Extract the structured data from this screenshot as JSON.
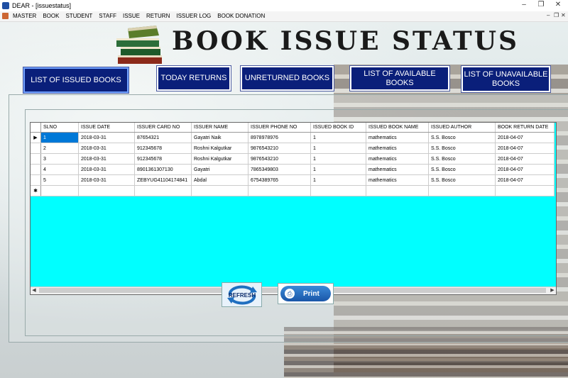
{
  "window": {
    "title": "DEAR - [issuestatus]",
    "minimize": "–",
    "restore": "❐",
    "close": "✕"
  },
  "menu": {
    "items": [
      "MASTER",
      "BOOK",
      "STUDENT",
      "STAFF",
      "ISSUE",
      "RETURN",
      "ISSUER LOG",
      "BOOK DONATION"
    ]
  },
  "page": {
    "title": "BOOK ISSUE STATUS"
  },
  "nav": {
    "list_issued": "LIST OF ISSUED BOOKS",
    "today_returns": "TODAY RETURNS",
    "unreturned": "UNRETURNED BOOKS",
    "available": "LIST OF AVAILABLE BOOKS",
    "unavailable": "LIST OF UNAVAILABLE BOOKS"
  },
  "grid": {
    "columns": [
      "SLNO",
      "ISSUE DATE",
      "ISSUER CARD NO",
      "ISSUER NAME",
      "ISSUER PHONE NO",
      "ISSUED BOOK ID",
      "ISSUED BOOK NAME",
      "ISSUED AUTHOR",
      "BOOK RETURN DATE"
    ],
    "rows": [
      [
        "1",
        "2018-03-31",
        "87654321",
        "Gayatri Naik",
        "8978978976",
        "1",
        "mathematics",
        "S.S. Bosco",
        "2018-04-07"
      ],
      [
        "2",
        "2018-03-31",
        "912345678",
        "Roshni Kalgutkar",
        "9876543210",
        "1",
        "mathematics",
        "S.S. Bosco",
        "2018-04-07"
      ],
      [
        "3",
        "2018-03-31",
        "912345678",
        "Roshni Kalgutkar",
        "9876543210",
        "1",
        "mathematics",
        "S.S. Bosco",
        "2018-04-07"
      ],
      [
        "4",
        "2018-03-31",
        "8901361307130",
        "Gayatri",
        "7865349803",
        "1",
        "mathematics",
        "S.S. Bosco",
        "2018-04-07"
      ],
      [
        "5",
        "2018-03-31",
        "ZEBYUG41104174841",
        "Abdal",
        "6754389765",
        "1",
        "mathematics",
        "S.S. Bosco",
        "2018-04-07"
      ]
    ],
    "current_row_marker": "▶",
    "new_row_marker": "✱"
  },
  "actions": {
    "refresh": "REFRESH",
    "print": "Print"
  },
  "colors": {
    "nav_bg": "#0a1f7a",
    "grid_empty": "#00ffff",
    "selection": "#0078d7"
  }
}
